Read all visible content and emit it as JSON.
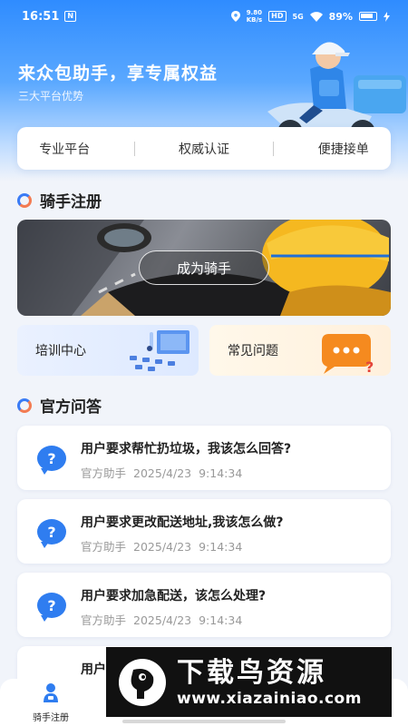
{
  "status_bar": {
    "time": "16:51",
    "app_badge": "N",
    "net_speed_top": "9.80",
    "net_speed_unit": "KB/s",
    "hd_badge": "HD",
    "signal_type": "5G",
    "battery_text": "89%"
  },
  "hero": {
    "title": "来众包助手，享专属权益",
    "subtitle": "三大平台优势"
  },
  "tabs": [
    "专业平台",
    "权威认证",
    "便捷接单"
  ],
  "rider_section": {
    "title": "骑手注册",
    "banner_button": "成为骑手",
    "quick_links": [
      "培训中心",
      "常见问题"
    ]
  },
  "qa_section": {
    "title": "官方问答",
    "items": [
      {
        "question": "用户要求帮忙扔垃圾，我该怎么回答?",
        "author": "官方助手",
        "date": "2025/4/23",
        "time": "9:14:34"
      },
      {
        "question": "用户要求更改配送地址,我该怎么做?",
        "author": "官方助手",
        "date": "2025/4/23",
        "time": "9:14:34"
      },
      {
        "question": "用户要求加急配送，该怎么处理?",
        "author": "官方助手",
        "date": "2025/4/23",
        "time": "9:14:34"
      },
      {
        "question": "用户"
      }
    ]
  },
  "bottom_nav": {
    "items": [
      {
        "label": "骑手注册",
        "icon": "rider-icon"
      }
    ]
  },
  "watermark": {
    "title": "下载鸟资源",
    "url": "www.xiazainiao.com"
  },
  "colors": {
    "accent": "#2f7df0",
    "hero_top": "#2f8cff",
    "page_bg": "#f1f4fa"
  }
}
